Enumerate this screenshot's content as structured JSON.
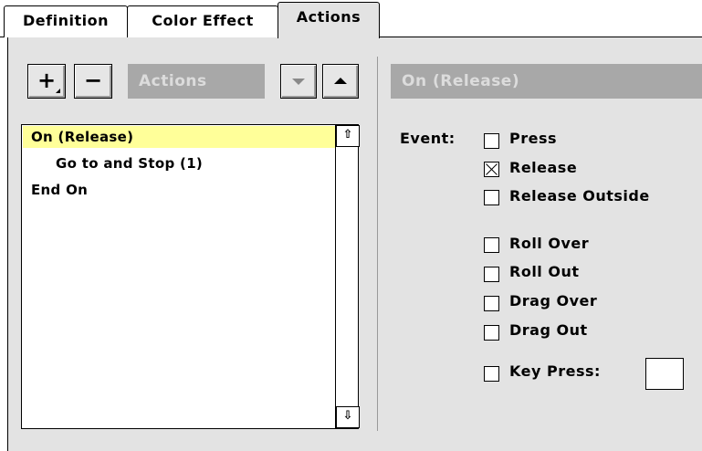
{
  "tabs": [
    {
      "label": "Definition",
      "active": false
    },
    {
      "label": "Color Effect",
      "active": false
    },
    {
      "label": "Actions",
      "active": true
    }
  ],
  "toolbar": {
    "add_label": "+",
    "remove_label": "−",
    "actions_menu_label": "Actions",
    "move_down_icon": "triangle-down-icon",
    "move_up_icon": "triangle-up-icon"
  },
  "script_lines": [
    {
      "text": "On (Release)",
      "indent": 0,
      "selected": true
    },
    {
      "text": "Go to and Stop (1)",
      "indent": 1,
      "selected": false
    },
    {
      "text": "End On",
      "indent": 0,
      "selected": false
    }
  ],
  "detail": {
    "header": "On (Release)",
    "event_label": "Event:",
    "events": [
      {
        "label": "Press",
        "checked": false
      },
      {
        "label": "Release",
        "checked": true
      },
      {
        "label": "Release Outside",
        "checked": false
      },
      {
        "label": "Roll Over",
        "checked": false
      },
      {
        "label": "Roll Out",
        "checked": false
      },
      {
        "label": "Drag Over",
        "checked": false
      },
      {
        "label": "Drag Out",
        "checked": false
      },
      {
        "label": "Key Press:",
        "checked": false
      }
    ],
    "key_press_value": ""
  },
  "colors": {
    "panel_bg": "#e3e3e3",
    "selection_highlight": "#ffff99",
    "dimmed_field": "#a8a8a8"
  }
}
